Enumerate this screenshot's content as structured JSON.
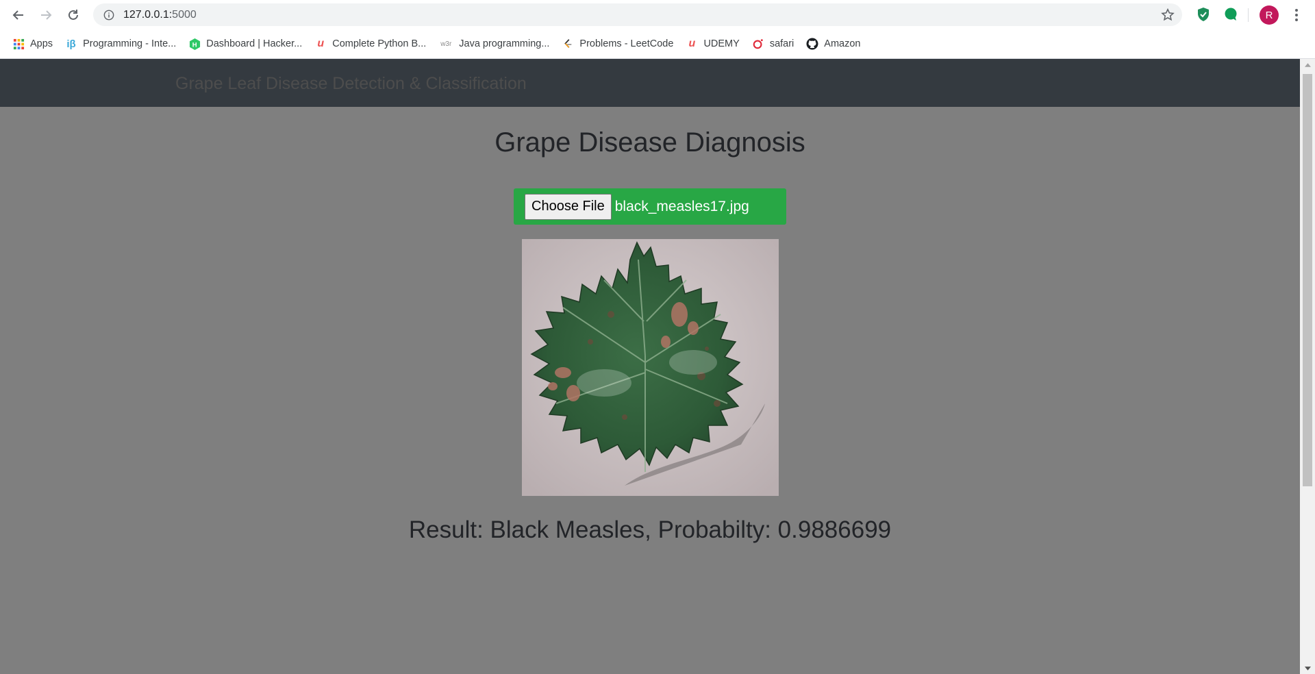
{
  "browser": {
    "url_host": "127.0.0.1:",
    "url_port": "5000",
    "profile_initial": "R",
    "bookmarks": [
      {
        "label": "Apps",
        "icon": "apps-grid-icon"
      },
      {
        "label": "Programming - Inte...",
        "icon": "interviewbit-icon"
      },
      {
        "label": "Dashboard | Hacker...",
        "icon": "hackerrank-icon"
      },
      {
        "label": "Complete Python B...",
        "icon": "udemy-icon"
      },
      {
        "label": "Java programming...",
        "icon": "w3r-icon"
      },
      {
        "label": "Problems - LeetCode",
        "icon": "leetcode-icon"
      },
      {
        "label": "UDEMY",
        "icon": "udemy-icon"
      },
      {
        "label": "safari",
        "icon": "safari-icon"
      },
      {
        "label": "Amazon",
        "icon": "github-icon"
      }
    ]
  },
  "navbar": {
    "brand": "Grape Leaf Disease Detection & Classification"
  },
  "main": {
    "heading": "Grape Disease Diagnosis",
    "file_button_label": "Choose File",
    "file_name": "black_measles17.jpg",
    "result": "Result: Black Measles, Probabilty: 0.9886699"
  },
  "colors": {
    "navbar_bg": "#343a40",
    "page_bg": "#7f7f7f",
    "upload_bg": "#28a745",
    "text_dark": "#222428"
  }
}
